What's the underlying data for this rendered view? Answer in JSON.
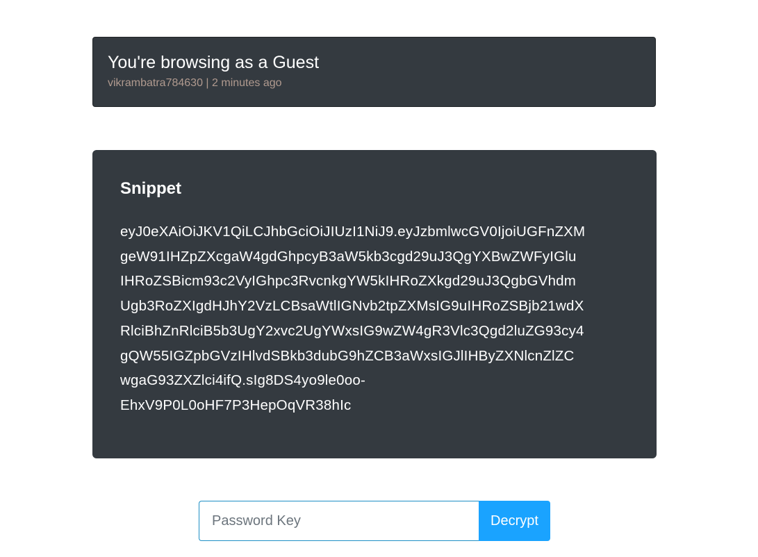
{
  "guest_card": {
    "title": "You're browsing as a Guest",
    "username": "vikrambatra784630",
    "separator": "|",
    "time_ago": "2 minutes ago"
  },
  "snippet": {
    "heading": "Snippet",
    "lines": [
      "eyJ0eXAiOiJKV1QiLCJhbGciOiJIUzI1NiJ9.eyJzbmlwcGV0IjoiUGFnZXM",
      "geW91IHZpZXcgaW4gdGhpcyB3aW5kb3cgd29uJ3QgYXBwZWFyIGlu",
      "IHRoZSBicm93c2VyIGhpc3RvcnkgYW5kIHRoZXkgd29uJ3QgbGVhdm",
      "Ugb3RoZXIgdHJhY2VzLCBsaWtlIGNvb2tpZXMsIG9uIHRoZSBjb21wdX",
      "RlciBhZnRlciB5b3UgY2xvc2UgYWxsIG9wZW4gR3Vlc3Qgd2luZG93cy4",
      "gQW55IGZpbGVzIHlvdSBkb3dubG9hZCB3aWxsIGJlIHByZXNlcnZlZC",
      "wgaG93ZXZlci4ifQ.sIg8DS4yo9le0oo-",
      "EhxV9P0L0oHF7P3HepOqVR38hIc"
    ]
  },
  "form": {
    "password_placeholder": "Password Key",
    "decrypt_label": "Decrypt"
  },
  "colors": {
    "card_background": "#343a40",
    "meta_text": "#b09a8f",
    "accent": "#1aa3ff",
    "input_border": "#1e8fc5"
  }
}
